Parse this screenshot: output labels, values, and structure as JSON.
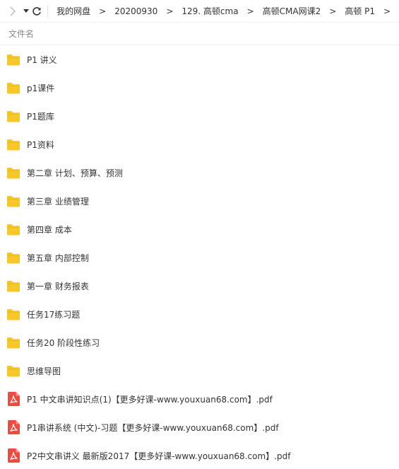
{
  "breadcrumb": [
    "我的网盘",
    "20200930",
    "129. 高顿cma",
    "高顿CMA网课2",
    "高顿 P1"
  ],
  "breadcrumb_separator": ">",
  "list_header": {
    "name_column": "文件名"
  },
  "items": [
    {
      "name": "P1 讲义",
      "type": "folder"
    },
    {
      "name": "p1课件",
      "type": "folder"
    },
    {
      "name": "P1题库",
      "type": "folder"
    },
    {
      "name": "P1资料",
      "type": "folder"
    },
    {
      "name": "第二章 计划、预算、预测",
      "type": "folder"
    },
    {
      "name": "第三章 业绩管理",
      "type": "folder"
    },
    {
      "name": "第四章 成本",
      "type": "folder"
    },
    {
      "name": "第五章 内部控制",
      "type": "folder"
    },
    {
      "name": "第一章 财务报表",
      "type": "folder"
    },
    {
      "name": "任务17练习题",
      "type": "folder"
    },
    {
      "name": "任务20 阶段性练习",
      "type": "folder"
    },
    {
      "name": "思维导图",
      "type": "folder"
    },
    {
      "name": "P1 中文串讲知识点(1)【更多好课-www.youxuan68.com】.pdf",
      "type": "pdf"
    },
    {
      "name": "P1串讲系统 (中文)-习题【更多好课-www.youxuan68.com】.pdf",
      "type": "pdf"
    },
    {
      "name": "P2中文串讲义 最新版2017【更多好课-www.youxuan68.com】.pdf",
      "type": "pdf"
    }
  ],
  "colors": {
    "folder": "#f5c728",
    "pdf": "#ee4b3e",
    "accent": "#333333"
  }
}
